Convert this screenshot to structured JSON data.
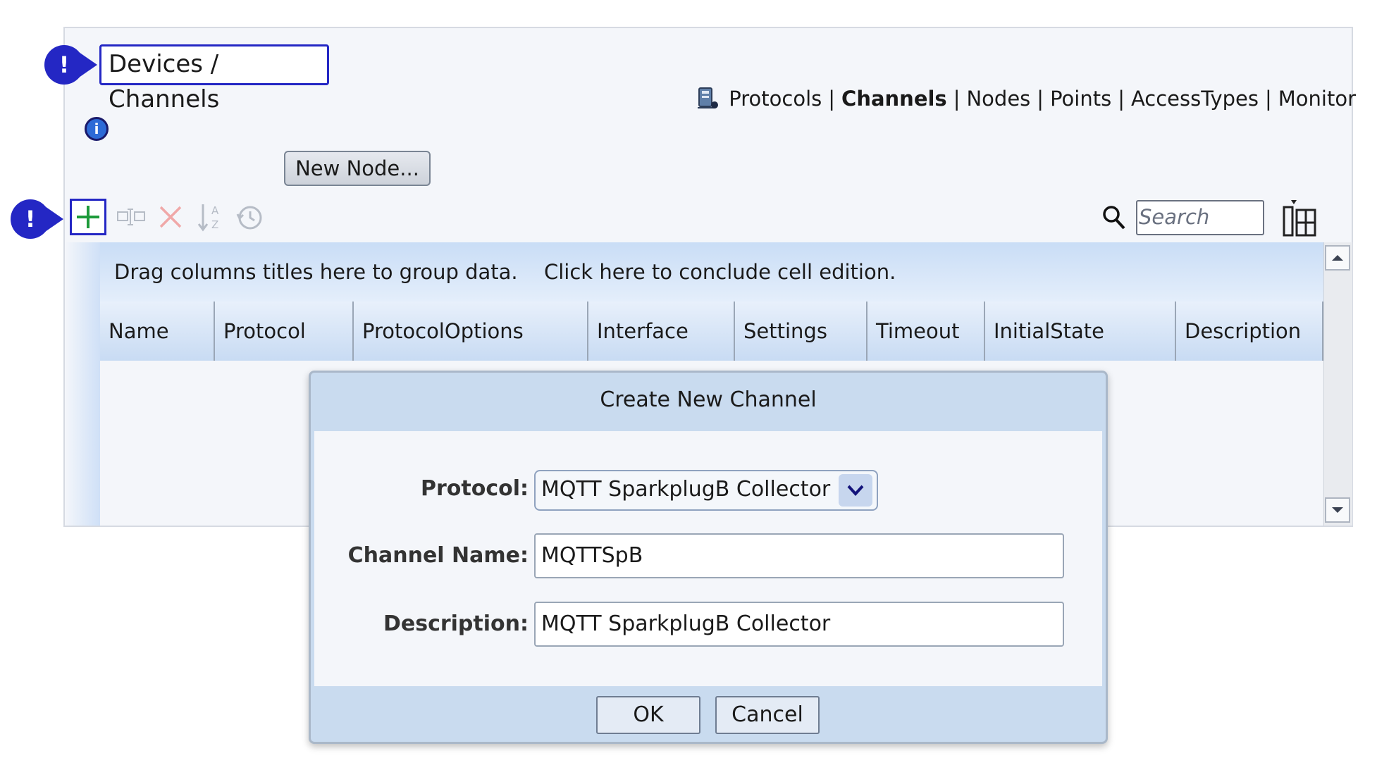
{
  "header": {
    "title": "Devices / Channels",
    "nav": [
      {
        "label": "Protocols",
        "active": false
      },
      {
        "label": "Channels",
        "active": true
      },
      {
        "label": "Nodes",
        "active": false
      },
      {
        "label": "Points",
        "active": false
      },
      {
        "label": "AccessTypes",
        "active": false
      },
      {
        "label": "Monitor",
        "active": false
      }
    ],
    "separator": "|"
  },
  "markers": {
    "symbol": "!",
    "color": "#2427c4"
  },
  "info_icon": {
    "glyph": "i"
  },
  "new_node_button": "New Node...",
  "toolbar": {
    "icons": [
      "add-icon",
      "rename-icon",
      "delete-icon",
      "sort-az-icon",
      "history-icon"
    ],
    "search_placeholder": "Search"
  },
  "grid": {
    "group_hint": "Drag columns titles here to group data.",
    "conclude_hint": "Click here to conclude cell edition.",
    "columns": [
      "Name",
      "Protocol",
      "ProtocolOptions",
      "Interface",
      "Settings",
      "Timeout",
      "InitialState",
      "Description"
    ]
  },
  "dialog": {
    "title": "Create New Channel",
    "protocol_label": "Protocol:",
    "protocol_value": "MQTT SparkplugB Collector",
    "channel_name_label": "Channel Name:",
    "channel_name_value": "MQTTSpB",
    "description_label": "Description:",
    "description_value": "MQTT SparkplugB Collector",
    "ok_label": "OK",
    "cancel_label": "Cancel"
  }
}
